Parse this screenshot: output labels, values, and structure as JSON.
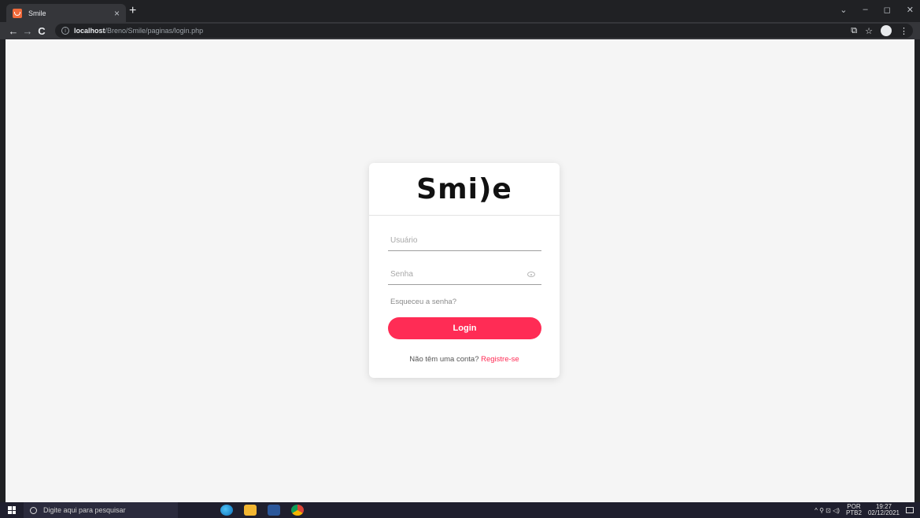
{
  "browser": {
    "tab_title": "Smile",
    "tab_close": "×",
    "new_tab": "+",
    "url_host": "localhost",
    "url_path": "/Breno/Smile/paginas/login.php",
    "nav": {
      "back": "←",
      "forward": "→",
      "reload": "C"
    },
    "window": {
      "dropdown": "⌄",
      "minimize": "–",
      "restore": "◻",
      "close": "✕"
    },
    "toolbar_right": {
      "share": "⧉",
      "bookmark": "☆",
      "menu": "⋮"
    }
  },
  "login": {
    "logo_text": "Smi)e",
    "username_placeholder": "Usuário",
    "password_placeholder": "Senha",
    "forgot_password": "Esqueceu a senha?",
    "login_button": "Login",
    "register_prompt": "Não têm uma conta?",
    "register_link": "Registre-se"
  },
  "taskbar": {
    "search_placeholder": "Digite aqui para pesquisar",
    "language_top": "POR",
    "language_bottom": "PTB2",
    "time": "19:27",
    "date": "02/12/2021",
    "tray_icons": "^ ⚲ ⊡ ◁)"
  },
  "icons": [
    "favicon-icon",
    "info-icon",
    "eye-icon",
    "windows-icon",
    "search-icon",
    "edge-icon",
    "file-explorer-icon",
    "word-icon",
    "chrome-icon"
  ],
  "colors": {
    "accent": "#ff2c55",
    "page_bg": "#f5f5f5",
    "chrome_dark": "#202124",
    "chrome_toolbar": "#35363a"
  }
}
